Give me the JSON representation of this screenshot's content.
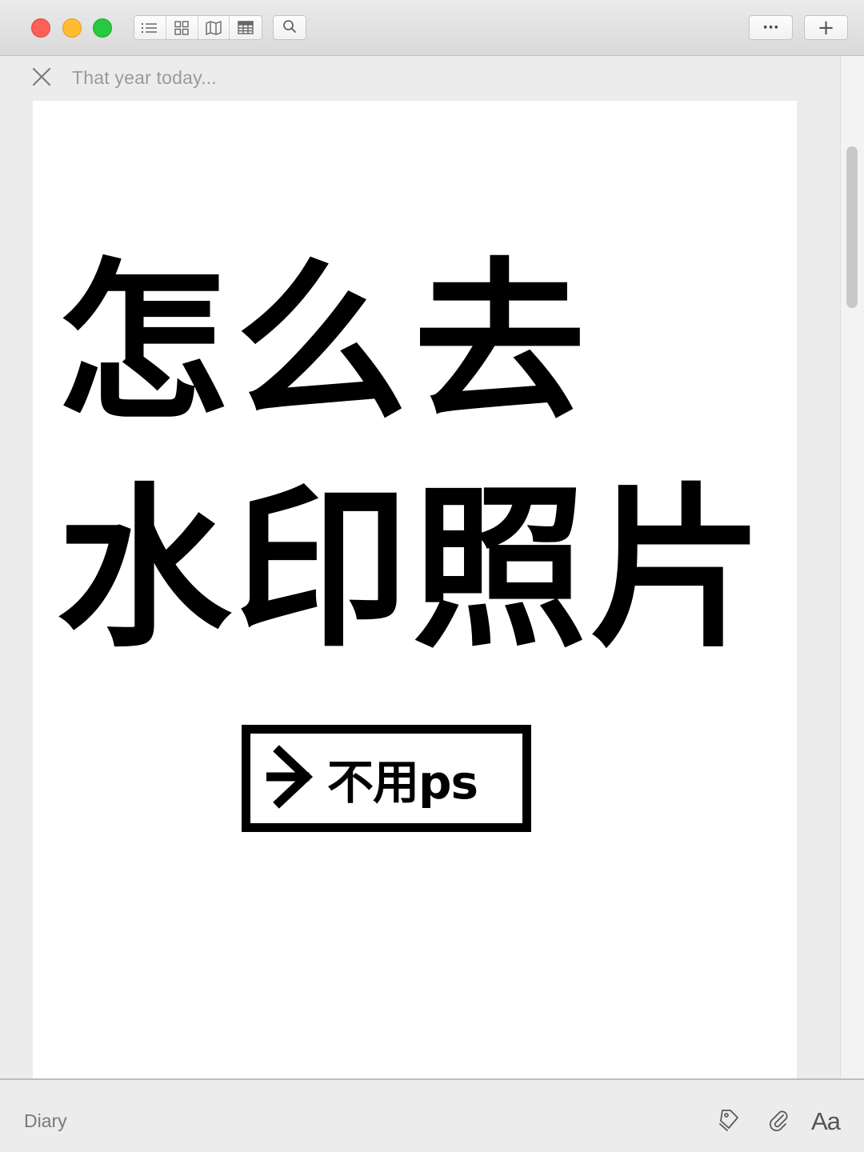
{
  "window": {
    "toolbar": {
      "view_icons": [
        "list-view-icon",
        "grid-view-icon",
        "map-view-icon",
        "calendar-view-icon"
      ],
      "search_icon": "search-icon",
      "more_label": "···",
      "add_label": "+"
    }
  },
  "entry": {
    "title_placeholder": "That year today...",
    "headline_line1": "怎么去",
    "headline_line2": "水印照片",
    "tag_text": "不用ps"
  },
  "footer": {
    "journal_name": "Diary",
    "font_button": "Aa"
  },
  "colors": {
    "close": "#fe5f57",
    "minimize": "#febc2e",
    "maximize": "#28c840",
    "headline": "#000000",
    "page": "#ffffff",
    "chrome": "#ececec"
  }
}
